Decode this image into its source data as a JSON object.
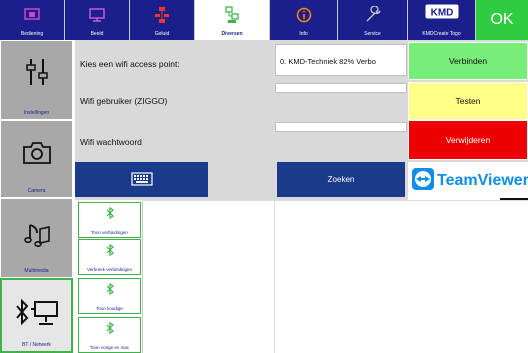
{
  "topbar": {
    "tabs": [
      {
        "label": "Bediening",
        "icon": "monitor-tv-icon"
      },
      {
        "label": "Beeld",
        "icon": "display-icon"
      },
      {
        "label": "Geluid",
        "icon": "speaker-network-icon"
      },
      {
        "label": "Diversen",
        "icon": "network-settings-icon"
      },
      {
        "label": "Info",
        "icon": "info-icon"
      },
      {
        "label": "Service",
        "icon": "wrench-icon"
      },
      {
        "label": "KMDCreate Togo",
        "icon": "kmd-logo"
      },
      {
        "label": "OK"
      }
    ],
    "active_tab": "Diversen",
    "kmd_logo_text": "KMD"
  },
  "sidebar": {
    "items": [
      {
        "label": "Instellingen",
        "icon": "settings-sliders-icon"
      },
      {
        "label": "Camera",
        "icon": "camera-icon"
      },
      {
        "label": "Multimedia",
        "icon": "music-note-icon"
      },
      {
        "label": "BT / Netwerk",
        "icon": "bluetooth-network-icon"
      }
    ],
    "active_item": "BT / Netwerk"
  },
  "wifi": {
    "ap_label": "Kies een wifi access point:",
    "ap_value": "0. KMD-Techniek 82% Verbo",
    "user_label": "Wifi gebruiker (ZIGGO)",
    "user_value": "",
    "password_label": "Wifi wachtwoord",
    "password_value": ""
  },
  "buttons": {
    "connect": "Verbinden",
    "test": "Testen",
    "delete": "Verwijderen",
    "search": "Zoeken",
    "keyboard_icon": "keyboard-icon"
  },
  "teamviewer": {
    "text": "TeamViewer"
  },
  "bluetooth": {
    "items": [
      {
        "label": "Toon verbindingen",
        "icon": "bluetooth-icon"
      },
      {
        "label": "Verbreek verbindingen",
        "icon": "bluetooth-icon"
      },
      {
        "label": "Toon koudige",
        "icon": "bluetooth-icon"
      },
      {
        "label": "Toon vorige en mac",
        "icon": "bluetooth-icon"
      }
    ]
  },
  "colors": {
    "navy": "#1a1f8c",
    "green": "#2ecc40",
    "yellow": "#ffff88",
    "red": "#ee0000",
    "light_green": "#77ee77",
    "gray": "#a8a8a8"
  }
}
